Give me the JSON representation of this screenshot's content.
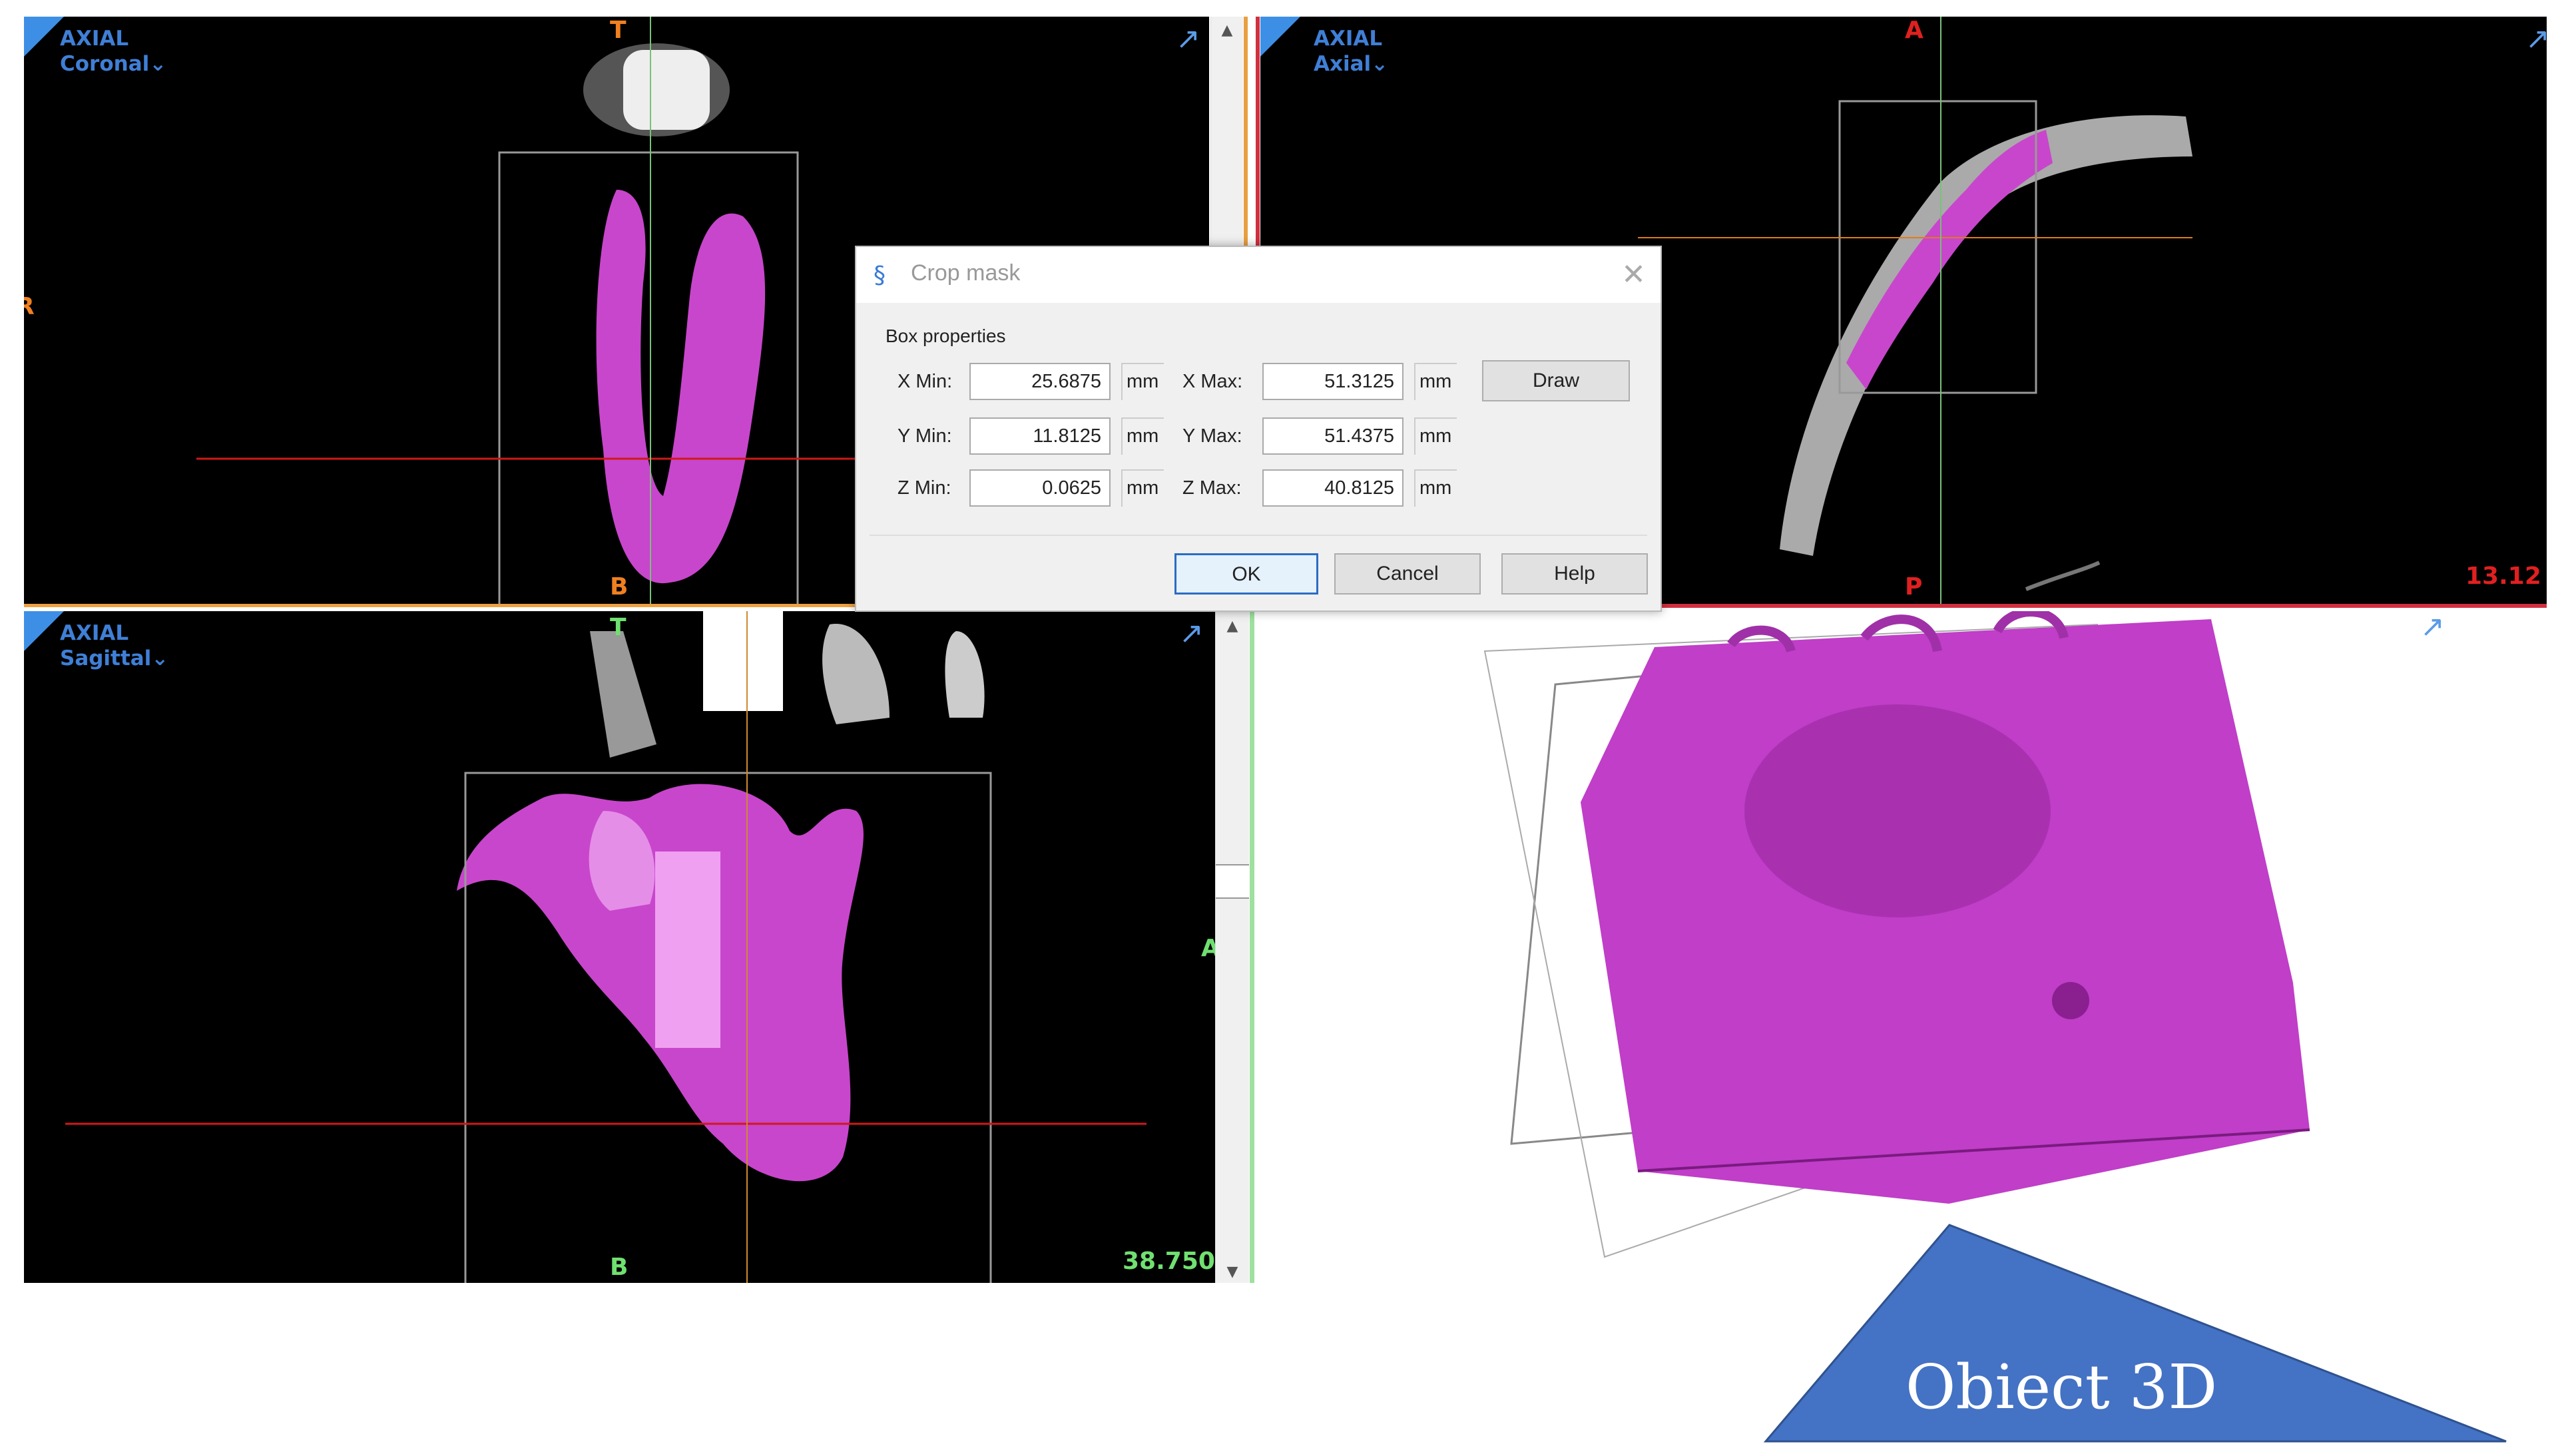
{
  "views": {
    "coronal": {
      "plane": "AXIAL",
      "view": "Coronal",
      "top": "T",
      "bottom": "B",
      "left": "R"
    },
    "axial": {
      "plane": "AXIAL",
      "view": "Axial",
      "top": "A",
      "bottom": "P",
      "value": "13.12"
    },
    "sagittal": {
      "plane": "AXIAL",
      "view": "Sagittal",
      "top": "T",
      "bottom": "B",
      "right": "A",
      "value": "38.750"
    }
  },
  "icons": {
    "expand": "↗",
    "dropdown": "⌄",
    "scroll_up": "▲",
    "scroll_down": "▼",
    "close": "✕"
  },
  "dialog": {
    "title": "Crop mask",
    "group": "Box properties",
    "rows": [
      {
        "min_label": "X Min:",
        "min_value": "25.6875",
        "max_label": "X Max:",
        "max_value": "51.3125"
      },
      {
        "min_label": "Y Min:",
        "min_value": "11.8125",
        "max_label": "Y Max:",
        "max_value": "51.4375"
      },
      {
        "min_label": "Z Min:",
        "min_value": "0.0625",
        "max_label": "Z Max:",
        "max_value": "40.8125"
      }
    ],
    "unit": "mm",
    "draw": "Draw",
    "ok": "OK",
    "cancel": "Cancel",
    "help": "Help"
  },
  "callout": {
    "text": "Obiect 3D",
    "color": "#4472c4"
  },
  "colors": {
    "mask": "#c040c8",
    "label_blue": "#3f7fd6",
    "orange": "#f08020",
    "red": "#e02020",
    "green": "#70e070"
  }
}
